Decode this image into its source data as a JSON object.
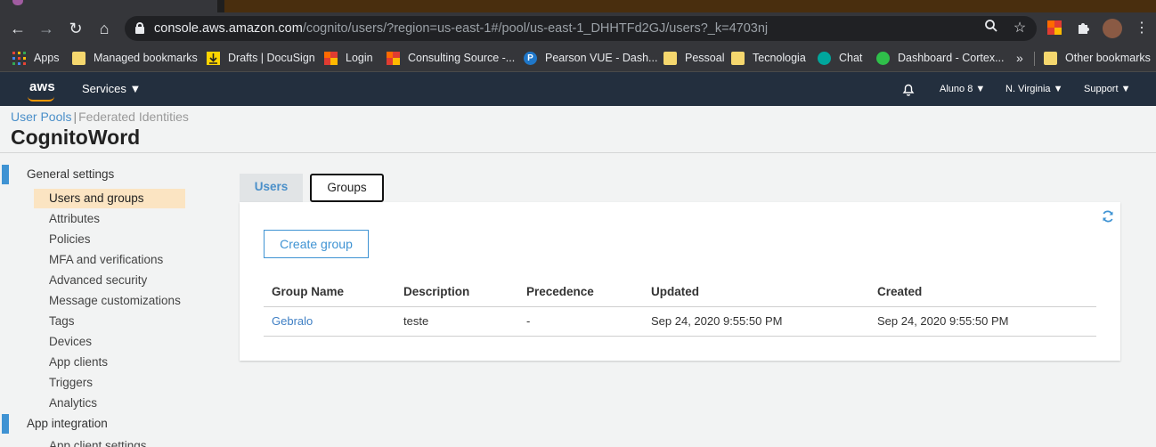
{
  "browser": {
    "url_host": "console.aws.amazon.com",
    "url_path": "/cognito/users/?region=us-east-1#/pool/us-east-1_DHHTFd2GJ/users?_k=4703nj",
    "bookmarks": [
      {
        "label": "Apps",
        "icon": "apps-grid-icon"
      },
      {
        "label": "Managed bookmarks",
        "icon": "folder-icon"
      },
      {
        "label": "Drafts | DocuSign",
        "icon": "docusign-icon"
      },
      {
        "label": "Login",
        "icon": "office-icon"
      },
      {
        "label": "Consulting Source -...",
        "icon": "office-icon"
      },
      {
        "label": "Pearson VUE - Dash...",
        "icon": "pearson-icon"
      },
      {
        "label": "Pessoal",
        "icon": "folder-icon"
      },
      {
        "label": "Tecnologia",
        "icon": "folder-icon"
      },
      {
        "label": "Chat",
        "icon": "chat-icon"
      },
      {
        "label": "Dashboard - Cortex...",
        "icon": "cortex-icon"
      }
    ],
    "overflow": "»",
    "other_bookmarks": "Other bookmarks"
  },
  "aws": {
    "logo": "aws",
    "services": "Services",
    "user": "Aluno 8",
    "region": "N. Virginia",
    "support": "Support"
  },
  "breadcrumb": {
    "user_pools": "User Pools",
    "separator": "|",
    "federated": "Federated Identities"
  },
  "pool_name": "CognitoWord",
  "sidebar": {
    "general_settings": "General settings",
    "items": [
      "Users and groups",
      "Attributes",
      "Policies",
      "MFA and verifications",
      "Advanced security",
      "Message customizations",
      "Tags",
      "Devices",
      "App clients",
      "Triggers",
      "Analytics"
    ],
    "app_integration": "App integration",
    "app_client_settings": "App client settings"
  },
  "tabs": {
    "users": "Users",
    "groups": "Groups"
  },
  "groups_panel": {
    "create_button": "Create group",
    "columns": [
      "Group Name",
      "Description",
      "Precedence",
      "Updated",
      "Created"
    ],
    "rows": [
      [
        "Gebralo",
        "teste",
        "-",
        "Sep 24, 2020 9:55:50 PM",
        "Sep 24, 2020 9:55:50 PM"
      ]
    ]
  },
  "colors": {
    "aws_header": "#232f3e",
    "aws_orange": "#ff9900",
    "link_blue": "#3f93d3",
    "active_item": "#fbe4c2"
  }
}
